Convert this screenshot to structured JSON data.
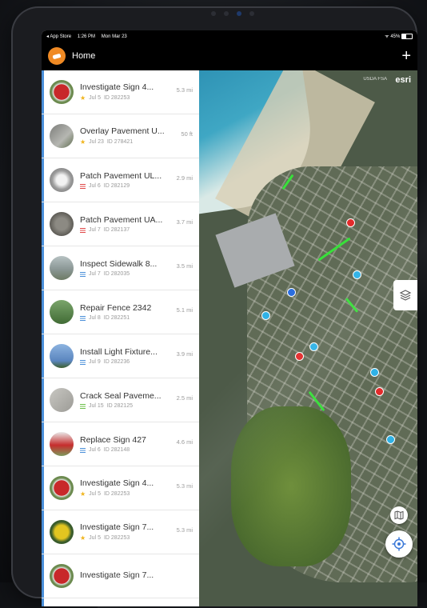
{
  "status_bar": {
    "back_app": "◂ App Store",
    "time": "1:26 PM",
    "date": "Mon Mar 23",
    "battery": "45%"
  },
  "nav": {
    "title": "Home",
    "add_label": "+"
  },
  "work_orders": [
    {
      "title": "Investigate Sign 4...",
      "date": "Jul 5",
      "id": "ID 282253",
      "distance": "5.3 mi",
      "marker": "star",
      "thumb": "stop"
    },
    {
      "title": "Overlay Pavement U...",
      "date": "Jul 23",
      "id": "ID 278421",
      "distance": "50 ft",
      "marker": "star",
      "thumb": "road"
    },
    {
      "title": "Patch Pavement UL...",
      "date": "Jul 6",
      "id": "ID 282129",
      "distance": "2.9 mi",
      "marker": "bars-red",
      "thumb": "pipe"
    },
    {
      "title": "Patch Pavement UA...",
      "date": "Jul 7",
      "id": "ID 282137",
      "distance": "3.7 mi",
      "marker": "bars-red",
      "thumb": "rock"
    },
    {
      "title": "Inspect Sidewalk 8...",
      "date": "Jul 7",
      "id": "ID 282035",
      "distance": "3.5 mi",
      "marker": "bars-blue",
      "thumb": "sidewalk"
    },
    {
      "title": "Repair Fence 2342",
      "date": "Jul 8",
      "id": "ID 282251",
      "distance": "5.1 mi",
      "marker": "bars-blue",
      "thumb": "fence"
    },
    {
      "title": "Install Light Fixture...",
      "date": "Jul 9",
      "id": "ID 282236",
      "distance": "3.9 mi",
      "marker": "bars-blue",
      "thumb": "light"
    },
    {
      "title": "Crack Seal Paveme...",
      "date": "Jul 15",
      "id": "ID 282125",
      "distance": "2.5 mi",
      "marker": "bars-green",
      "thumb": "crack"
    },
    {
      "title": "Replace Sign 427",
      "date": "Jul 6",
      "id": "ID 282148",
      "distance": "4.6 mi",
      "marker": "bars-blue",
      "thumb": "sign"
    },
    {
      "title": "Investigate Sign 4...",
      "date": "Jul 5",
      "id": "ID 282253",
      "distance": "5.3 mi",
      "marker": "star",
      "thumb": "stop"
    },
    {
      "title": "Investigate Sign 7...",
      "date": "Jul 5",
      "id": "ID 282253",
      "distance": "5.3 mi",
      "marker": "star",
      "thumb": "ysign"
    },
    {
      "title": "Investigate Sign 7...",
      "date": "",
      "id": "",
      "distance": "",
      "marker": "",
      "thumb": "stop"
    }
  ],
  "map": {
    "attribution": "USDA FSA",
    "logo": "esri",
    "colors": {
      "pin_red": "#e32b2b",
      "pin_cyan": "#2fb2e6",
      "pin_blue": "#2b6ee0",
      "route": "#38e03a"
    }
  },
  "colors": {
    "accent": "#4a8fd9",
    "app_logo": "#f08a24",
    "star": "#f0b41c",
    "priority_red": "#e04848",
    "priority_blue": "#4a8fd9",
    "priority_green": "#6cc04a"
  },
  "icons": [
    "app-logo-icon",
    "plus-icon",
    "star-icon",
    "priority-bars-icon",
    "layers-icon",
    "basemap-icon",
    "locate-icon"
  ]
}
